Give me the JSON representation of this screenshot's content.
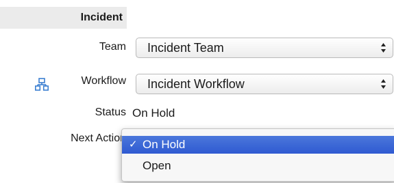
{
  "section": {
    "title": "Incident"
  },
  "fields": {
    "team": {
      "label": "Team",
      "value": "Incident Team"
    },
    "workflow": {
      "label": "Workflow",
      "value": "Incident Workflow",
      "icon": "workflow-icon"
    },
    "status": {
      "label": "Status",
      "value": "On Hold"
    },
    "next_action": {
      "label": "Next Action"
    }
  },
  "dropdown": {
    "options": [
      {
        "label": "On Hold",
        "selected": true,
        "check": "✓"
      },
      {
        "label": "Open",
        "selected": false
      }
    ]
  },
  "colors": {
    "header_bg": "#ebebeb",
    "selection": "#3563d6",
    "icon": "#3b7fd1"
  }
}
